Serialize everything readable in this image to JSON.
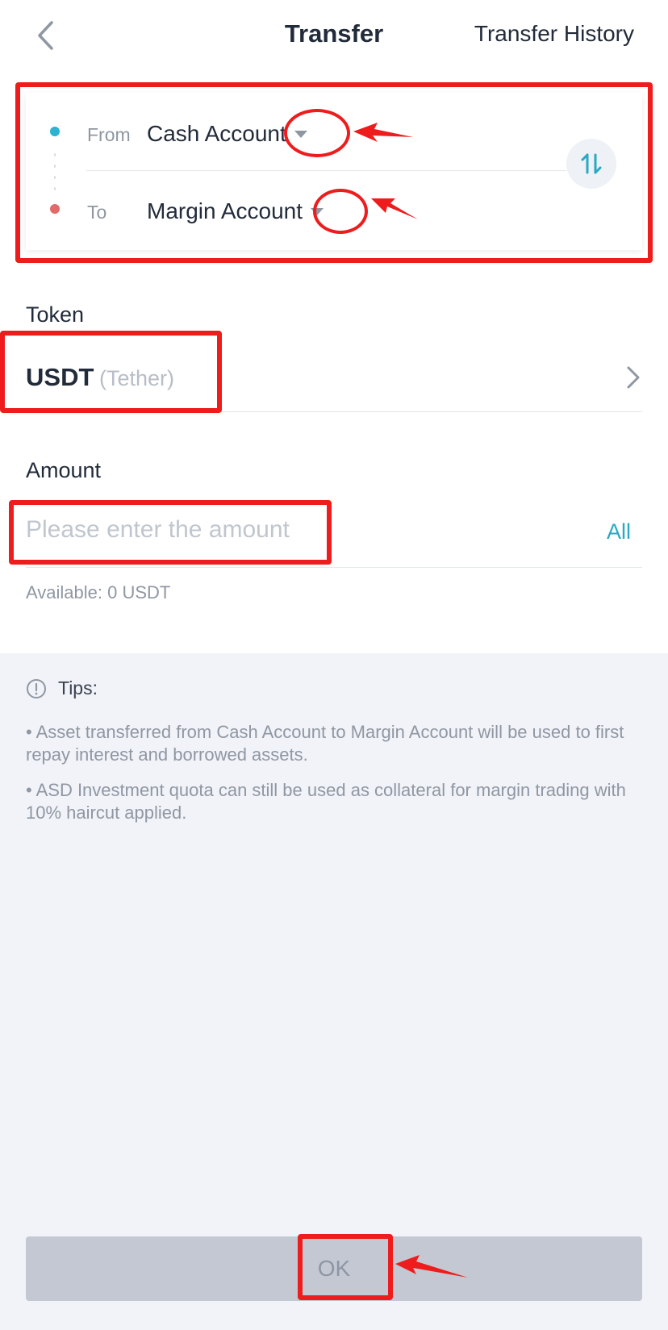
{
  "header": {
    "title": "Transfer",
    "history_label": "Transfer History",
    "back_icon": "chevron-left-icon"
  },
  "account_card": {
    "from_label": "From",
    "from_value": "Cash Account",
    "to_label": "To",
    "to_value": "Margin Account",
    "swap_icon": "swap-vertical-icon",
    "from_dot_color": "#2bb3cf",
    "to_dot_color": "#e26a6a"
  },
  "token": {
    "label": "Token",
    "symbol": "USDT",
    "name": "(Tether)"
  },
  "amount": {
    "label": "Amount",
    "placeholder": "Please enter the amount",
    "all_label": "All",
    "available": "Available: 0 USDT"
  },
  "tips": {
    "title": "Tips:",
    "items": [
      "• Asset transferred from Cash Account to Margin Account will be used to first repay interest and borrowed assets.",
      "• ASD Investment quota can still be used as collateral for margin trading with 10% haircut applied."
    ]
  },
  "ok_button": {
    "label": "OK"
  },
  "colors": {
    "accent": "#28a9c4",
    "annotation_red": "#ee1c1c",
    "tips_background": "#f1f3f8",
    "button_disabled": "#c3c8d3"
  }
}
